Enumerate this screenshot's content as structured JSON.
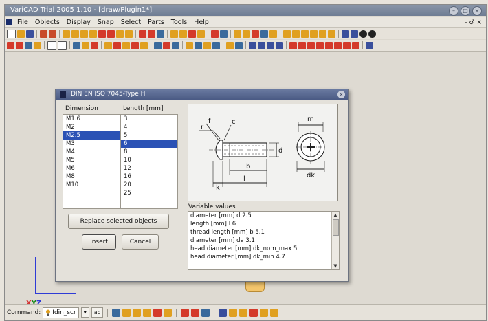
{
  "window": {
    "title": "VariCAD Trial 2005 1.10 - [draw/Plugin1*]",
    "controls": [
      "–",
      "□",
      "×"
    ]
  },
  "menu": {
    "items": [
      "File",
      "Objects",
      "Display",
      "Snap",
      "Select",
      "Parts",
      "Tools",
      "Help"
    ],
    "right_controls": "- ♂ ×"
  },
  "statusbar": {
    "command_label": "Command:",
    "command_value": "Idin_scr",
    "toggle_label": "ac"
  },
  "axes": {
    "x": "X",
    "y": "Y",
    "z": "Z"
  },
  "dialog": {
    "title": "DIN EN ISO 7045-Type H",
    "dimension_header": "Dimension",
    "length_header": "Length [mm]",
    "dimensions": [
      "M1.6",
      "M2",
      "M2.5",
      "M3",
      "M4",
      "M5",
      "M6",
      "M8",
      "M10"
    ],
    "dimension_selected_index": 2,
    "lengths": [
      "3",
      "4",
      "5",
      "6",
      "8",
      "10",
      "12",
      "16",
      "20",
      "25"
    ],
    "length_selected_index": 3,
    "variable_values_label": "Variable values",
    "variable_values": [
      "diameter [mm] d 2.5",
      "length [mm] l 6",
      "thread length [mm] b 5.1",
      "diameter [mm] da 3.1",
      "head diameter [mm] dk_nom_max 5",
      "head diameter [mm] dk_min 4.7"
    ],
    "buttons": {
      "replace": "Replace selected objects",
      "insert": "Insert",
      "cancel": "Cancel"
    },
    "preview_labels": {
      "r": "r",
      "f": "f",
      "c": "c",
      "b": "b",
      "l": "l",
      "k": "k",
      "d": "d",
      "m": "m",
      "dk": "dk"
    }
  },
  "colors": {
    "selection": "#2b52b5",
    "axis_x": "#d43030",
    "axis_y": "#1c8a1c",
    "axis_z": "#2f3bd6",
    "toolbar_icon_accent": "#e0a020"
  }
}
